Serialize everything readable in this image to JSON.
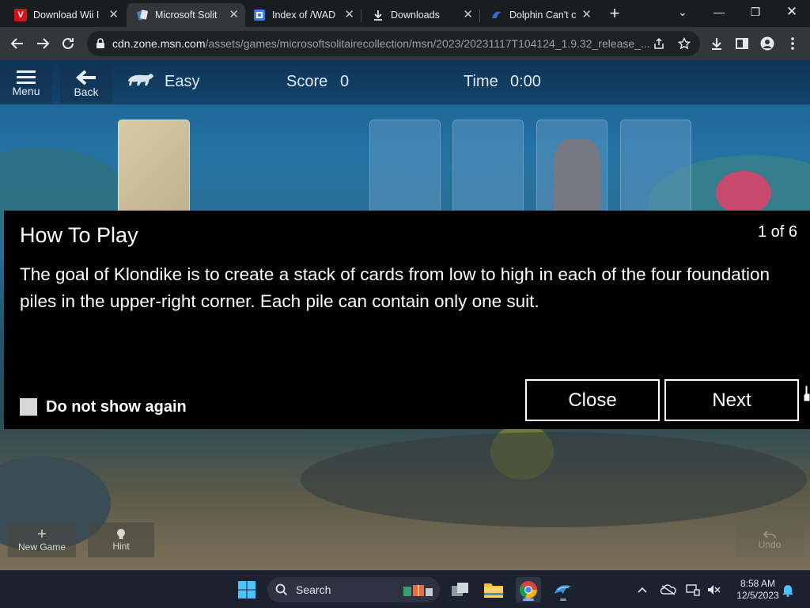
{
  "tabs": [
    {
      "title": "Download Wii I",
      "favicon": "V",
      "favicon_color": "#d0141a"
    },
    {
      "title": "Microsoft Solit",
      "favicon": "cards",
      "favicon_color": "#4c7fc9",
      "active": true
    },
    {
      "title": "Index of /WAD",
      "favicon": "index",
      "favicon_color": "#3b7de0"
    },
    {
      "title": "Downloads",
      "favicon": "download",
      "favicon_color": "#e8eaed"
    },
    {
      "title": "Dolphin Can't c",
      "favicon": "dolphin",
      "favicon_color": "#2a6fd1"
    }
  ],
  "address_bar": {
    "host": "cdn.zone.msn.com",
    "path": "/assets/games/microsoftsolitairecollection/msn/2023/20231117T104124_1.9.32_release_..."
  },
  "game_bar": {
    "menu_label": "Menu",
    "back_label": "Back",
    "difficulty": "Easy",
    "score_label": "Score",
    "score_value": "0",
    "time_label": "Time",
    "time_value": "0:00"
  },
  "dialog": {
    "title": "How To Play",
    "page": "1 of 6",
    "body": "The goal of Klondike is to create a stack of cards from low to high in each of the four foundation piles in the upper-right corner. Each pile can contain only one suit.",
    "checkbox_label": "Do not show again",
    "close_label": "Close",
    "next_label": "Next"
  },
  "bottom_bar": {
    "new_game_label": "New Game",
    "hint_label": "Hint",
    "undo_label": "Undo"
  },
  "taskbar": {
    "search_label": "Search",
    "time": "8:58 AM",
    "date": "12/5/2023"
  },
  "colors": {
    "chrome_dark": "#1b1c1f",
    "chrome_toolbar": "#35363a",
    "dialog_bg": "#000000",
    "taskbar_bg": "#1c2130"
  }
}
